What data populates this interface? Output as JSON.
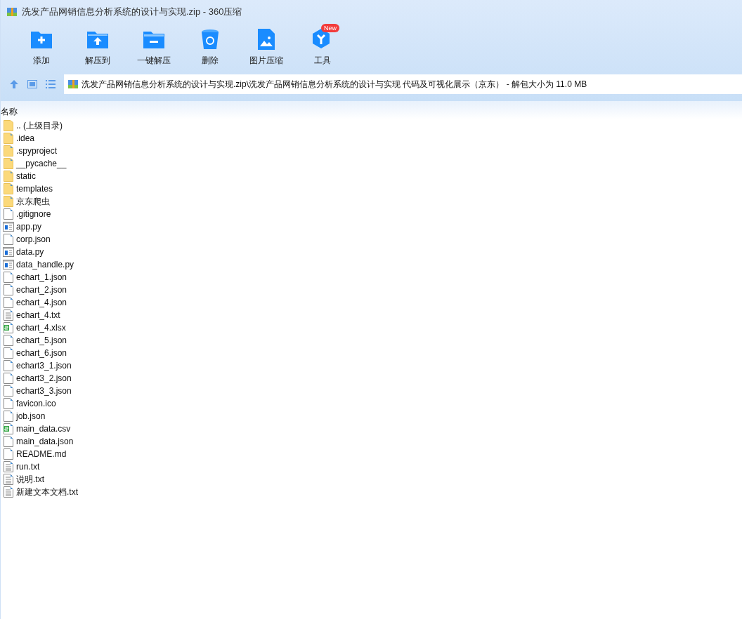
{
  "window": {
    "title": "洗发产品网销信息分析系统的设计与实现.zip - 360压缩"
  },
  "toolbar": [
    {
      "kind": "add",
      "label": "添加"
    },
    {
      "kind": "extract",
      "label": "解压到"
    },
    {
      "kind": "oneclick",
      "label": "一键解压"
    },
    {
      "kind": "delete",
      "label": "删除"
    },
    {
      "kind": "image",
      "label": "图片压缩"
    },
    {
      "kind": "tools",
      "label": "工具",
      "badge": "New"
    }
  ],
  "address_bar": {
    "path": "洗发产品网销信息分析系统的设计与实现.zip\\洗发产品网销信息分析系统的设计与实现 代码及可视化展示（京东） - 解包大小为 11.0 MB"
  },
  "file_list": {
    "columns": [
      "名称"
    ],
    "items": [
      {
        "kind": "folder-up",
        "name": ".. (上级目录)"
      },
      {
        "kind": "folder",
        "name": ".idea"
      },
      {
        "kind": "folder",
        "name": ".spyproject"
      },
      {
        "kind": "folder",
        "name": "__pycache__"
      },
      {
        "kind": "folder",
        "name": "static"
      },
      {
        "kind": "folder",
        "name": "templates"
      },
      {
        "kind": "folder",
        "name": "京东爬虫"
      },
      {
        "kind": "file",
        "name": ".gitignore"
      },
      {
        "kind": "script",
        "name": "app.py"
      },
      {
        "kind": "file",
        "name": "corp.json"
      },
      {
        "kind": "script",
        "name": "data.py"
      },
      {
        "kind": "script",
        "name": "data_handle.py"
      },
      {
        "kind": "file",
        "name": "echart_1.json"
      },
      {
        "kind": "file",
        "name": "echart_2.json"
      },
      {
        "kind": "file",
        "name": "echart_4.json"
      },
      {
        "kind": "text",
        "name": "echart_4.txt"
      },
      {
        "kind": "sheet",
        "name": "echart_4.xlsx"
      },
      {
        "kind": "file",
        "name": "echart_5.json"
      },
      {
        "kind": "file",
        "name": "echart_6.json"
      },
      {
        "kind": "file",
        "name": "echart3_1.json"
      },
      {
        "kind": "file",
        "name": "echart3_2.json"
      },
      {
        "kind": "file",
        "name": "echart3_3.json"
      },
      {
        "kind": "file",
        "name": "favicon.ico"
      },
      {
        "kind": "file",
        "name": "job.json"
      },
      {
        "kind": "sheet",
        "name": "main_data.csv"
      },
      {
        "kind": "file",
        "name": "main_data.json"
      },
      {
        "kind": "file",
        "name": "README.md"
      },
      {
        "kind": "text",
        "name": "run.txt"
      },
      {
        "kind": "text",
        "name": "说明.txt"
      },
      {
        "kind": "text",
        "name": "新建文本文档.txt"
      }
    ]
  }
}
